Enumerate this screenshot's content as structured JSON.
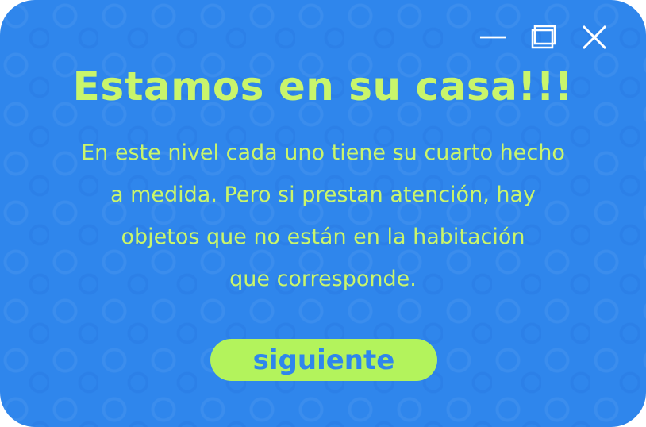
{
  "window": {
    "controls": [
      {
        "icon": "minimize-icon"
      },
      {
        "icon": "maximize-icon"
      },
      {
        "icon": "close-icon"
      }
    ],
    "background_color": "#2f86ec",
    "accent_color": "#c9f56b",
    "button_color": "#b3f35c"
  },
  "title": "Estamos en su casa!!!",
  "body_lines": [
    "En este nivel cada uno tiene su cuarto hecho",
    "a medida. Pero si prestan atención, hay",
    "objetos que no están en la habitación",
    "que corresponde."
  ],
  "next_button_label": "siguiente"
}
